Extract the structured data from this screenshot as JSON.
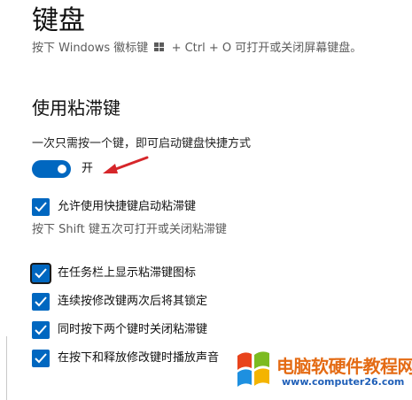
{
  "page": {
    "title": "键盘",
    "desc_before": "按下 Windows 徽标键",
    "desc_after": "+ Ctrl + O 可打开或关闭屏幕键盘。"
  },
  "sticky_keys": {
    "heading": "使用粘滞键",
    "sub_label": "一次只需按一个键，即可启动键盘快捷方式",
    "toggle_state": "开",
    "toggle_on": true,
    "accent_color": "#0067c0",
    "option_shortcut": "允许使用快捷键启动粘滞键",
    "shortcut_hint": "按下 Shift 键五次可打开或关闭粘滞键",
    "options": [
      {
        "label": "在任务栏上显示粘滞键图标",
        "checked": true
      },
      {
        "label": "连续按修改键两次后将其锁定",
        "checked": true
      },
      {
        "label": "同时按下两个键时关闭粘滞键",
        "checked": true
      },
      {
        "label": "在按下和释放修改键时播放声音",
        "checked": true
      }
    ]
  },
  "annotation": {
    "icon": "red-arrow-icon",
    "color": "#d6262a"
  },
  "watermark": {
    "name": "电脑软硬件教程网",
    "url": "www.computer26.com"
  }
}
